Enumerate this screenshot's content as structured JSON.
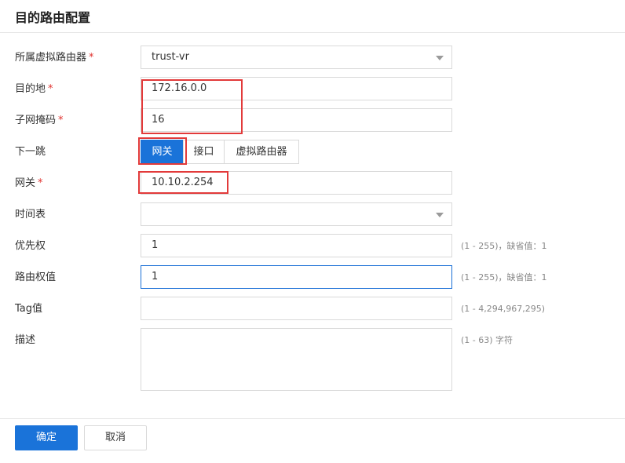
{
  "dialog": {
    "title": "目的路由配置"
  },
  "fields": {
    "vrouter": {
      "label": "所属虚拟路由器",
      "value": "trust-vr"
    },
    "destination": {
      "label": "目的地",
      "value": "172.16.0.0"
    },
    "subnet_mask": {
      "label": "子网掩码",
      "value": "16"
    },
    "next_hop": {
      "label": "下一跳",
      "options": [
        "网关",
        "接口",
        "虚拟路由器"
      ],
      "selected": "网关"
    },
    "gateway": {
      "label": "网关",
      "value": "10.10.2.254"
    },
    "schedule": {
      "label": "时间表",
      "value": ""
    },
    "priority": {
      "label": "优先权",
      "value": "1",
      "hint": "(1 - 255)，缺省值：1"
    },
    "weight": {
      "label": "路由权值",
      "value": "1",
      "hint": "(1 - 255)，缺省值：1"
    },
    "tag": {
      "label": "Tag值",
      "value": "",
      "hint": "(1 - 4,294,967,295)"
    },
    "description": {
      "label": "描述",
      "value": "",
      "hint": "(1 - 63) 字符"
    }
  },
  "required_mark": "*",
  "buttons": {
    "ok": "确定",
    "cancel": "取消"
  },
  "colors": {
    "accent": "#1a73d9",
    "required": "#e0322f",
    "highlight_box": "#e23a3a"
  }
}
